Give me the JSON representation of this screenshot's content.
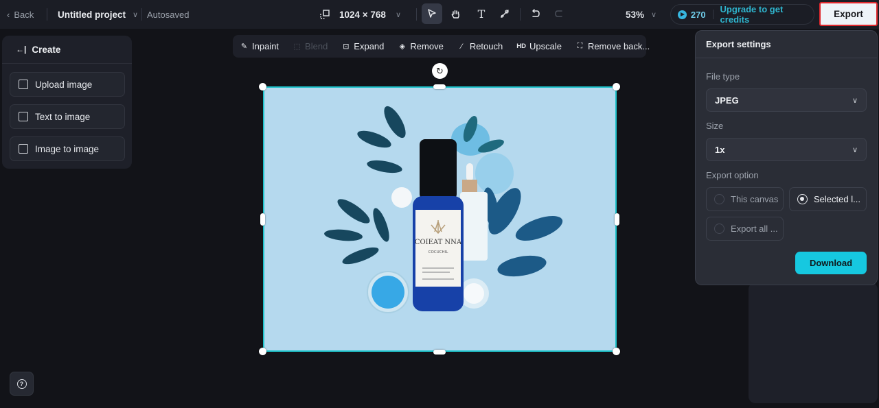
{
  "topbar": {
    "back_label": "Back",
    "project_name": "Untitled project",
    "save_status": "Autosaved",
    "canvas_size": "1024 × 768",
    "zoom_level": "53%",
    "credits": "270",
    "upgrade_label": "Upgrade to get credits",
    "export_label": "Export"
  },
  "tools": [
    {
      "name": "select",
      "icon": "pointer-icon",
      "active": true
    },
    {
      "name": "hand",
      "icon": "hand-icon",
      "active": false
    },
    {
      "name": "text",
      "icon": "text-icon",
      "active": false
    },
    {
      "name": "brush",
      "icon": "brush-icon",
      "active": false
    },
    {
      "name": "undo",
      "icon": "undo-icon",
      "active": false
    },
    {
      "name": "redo",
      "icon": "redo-icon",
      "disabled": true
    }
  ],
  "left_panel": {
    "header": "Create",
    "items": [
      {
        "label": "Upload image",
        "icon": "upload-image-icon"
      },
      {
        "label": "Text to image",
        "icon": "text-to-image-icon"
      },
      {
        "label": "Image to image",
        "icon": "image-to-image-icon"
      }
    ]
  },
  "image_tools": [
    {
      "label": "Inpaint",
      "icon": "inpaint-icon",
      "disabled": false
    },
    {
      "label": "Blend",
      "icon": "blend-icon",
      "disabled": true
    },
    {
      "label": "Expand",
      "icon": "expand-icon",
      "disabled": false
    },
    {
      "label": "Remove",
      "icon": "eraser-icon",
      "disabled": false
    },
    {
      "label": "Retouch",
      "icon": "magic-wand-icon",
      "disabled": false
    },
    {
      "label": "Upscale",
      "icon": "hd-icon",
      "disabled": false
    },
    {
      "label": "Remove back...",
      "icon": "remove-background-icon",
      "disabled": false
    }
  ],
  "canvas": {
    "image_description": "Skincare product arrangement on light blue background",
    "product_label": "COIEAT NNA",
    "product_sublabel": "COCUCHIL"
  },
  "export_panel": {
    "title": "Export settings",
    "file_type_label": "File type",
    "file_type_value": "JPEG",
    "size_label": "Size",
    "size_value": "1x",
    "export_option_label": "Export option",
    "options": [
      {
        "label": "This canvas",
        "selected": false
      },
      {
        "label": "Selected l...",
        "selected": true
      },
      {
        "label": "Export all ...",
        "selected": false
      }
    ],
    "download_label": "Download"
  },
  "colors": {
    "accent": "#16c8e0",
    "selection_border": "#1fc4cc",
    "export_highlight": "#e0282d",
    "canvas_bg": "#b5d9ee"
  }
}
